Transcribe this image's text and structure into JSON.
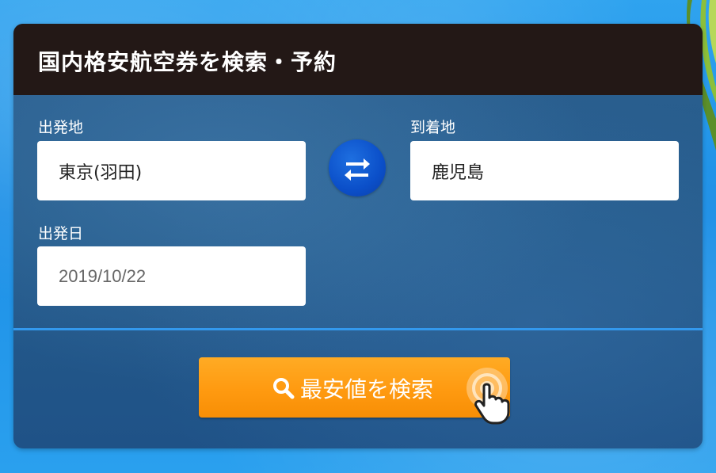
{
  "panel": {
    "title": "国内格安航空券を検索・予約"
  },
  "form": {
    "departure": {
      "label": "出発地",
      "value": "東京(羽田)"
    },
    "arrival": {
      "label": "到着地",
      "value": "鹿児島"
    },
    "date": {
      "label": "出発日",
      "value": "2019/10/22"
    },
    "swap_icon": "swap-arrows-icon"
  },
  "search_button": {
    "label": "最安値を検索",
    "icon": "search-icon",
    "pointer_icon": "tap-hand-icon"
  },
  "colors": {
    "header_bg": "#231816",
    "panel_bg": "#255b8b",
    "button_orange": "#ff9a10",
    "swap_blue": "#0b4fc9",
    "divider": "#3399ee"
  }
}
